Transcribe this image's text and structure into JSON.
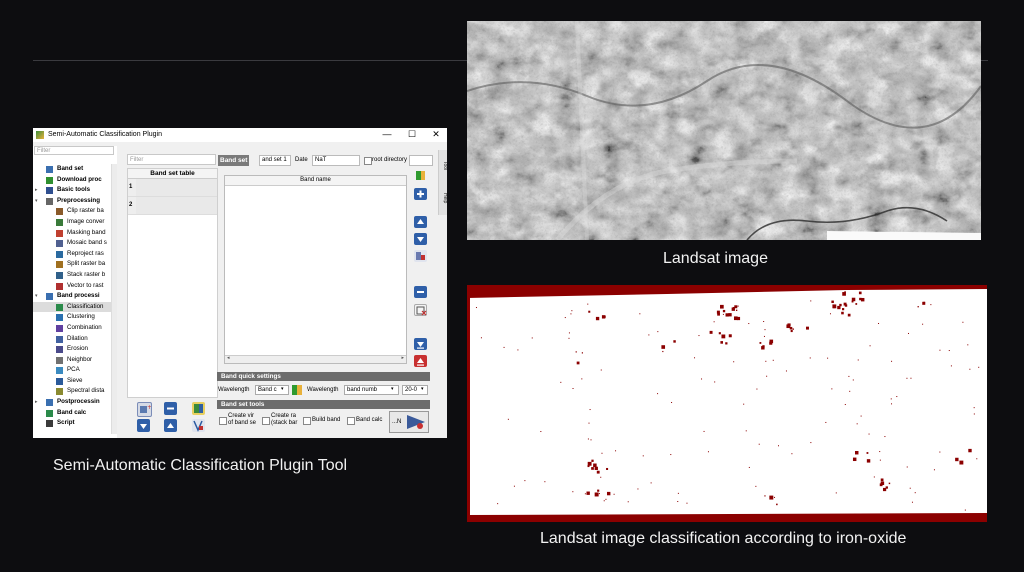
{
  "window": {
    "title": "Semi-Automatic Classification Plugin",
    "controls": {
      "minimize": "—",
      "maximize": "☐",
      "close": "✕"
    }
  },
  "sidebar": {
    "filter_placeholder": "Filter",
    "items": [
      {
        "label": "Band set",
        "bold": true,
        "level": 0,
        "icon": "band-set-icon",
        "color": "#3a6fb0"
      },
      {
        "label": "Download proc",
        "bold": true,
        "level": 0,
        "icon": "download-icon",
        "color": "#2f8f2f"
      },
      {
        "label": "Basic tools",
        "bold": true,
        "level": 0,
        "arrow": "▸",
        "icon": "toolbox-icon",
        "color": "#2f4f8f"
      },
      {
        "label": "Preprocessing",
        "bold": true,
        "level": 0,
        "arrow": "▾",
        "icon": "preprocessing-icon",
        "color": "#666666"
      },
      {
        "label": "Clip raster ba",
        "level": 1,
        "icon": "clip-icon",
        "color": "#8a5a2a"
      },
      {
        "label": "Image conver",
        "level": 1,
        "icon": "image-convert-icon",
        "color": "#3a7a3a"
      },
      {
        "label": "Masking band",
        "level": 1,
        "icon": "mask-icon",
        "color": "#c04030"
      },
      {
        "label": "Mosaic band s",
        "level": 1,
        "icon": "mosaic-icon",
        "color": "#506090"
      },
      {
        "label": "Reproject ras",
        "level": 1,
        "icon": "reproject-icon",
        "color": "#2a6aa0"
      },
      {
        "label": "Split raster ba",
        "level": 1,
        "icon": "split-icon",
        "color": "#a07020"
      },
      {
        "label": "Stack raster b",
        "level": 1,
        "icon": "stack-icon",
        "color": "#30608a"
      },
      {
        "label": "Vector to rast",
        "level": 1,
        "icon": "vector-to-raster-icon",
        "color": "#b03030"
      },
      {
        "label": "Band processi",
        "bold": true,
        "level": 0,
        "arrow": "▾",
        "icon": "band-processing-icon",
        "color": "#3a6fb0"
      },
      {
        "label": "Classification",
        "level": 1,
        "icon": "classification-icon",
        "color": "#2a8a4a",
        "selected": true
      },
      {
        "label": "Clustering",
        "level": 1,
        "icon": "clustering-icon",
        "color": "#2a70b0"
      },
      {
        "label": "Combination",
        "level": 1,
        "icon": "combination-icon",
        "color": "#6040a0"
      },
      {
        "label": "Dilation",
        "level": 1,
        "icon": "dilation-icon",
        "color": "#4060a0"
      },
      {
        "label": "Erosion",
        "level": 1,
        "icon": "erosion-icon",
        "color": "#4a4a8a"
      },
      {
        "label": "Neighbor",
        "level": 1,
        "icon": "neighbor-icon",
        "color": "#707070"
      },
      {
        "label": "PCA",
        "level": 1,
        "icon": "pca-icon",
        "color": "#3a8ac0"
      },
      {
        "label": "Sieve",
        "level": 1,
        "icon": "sieve-icon",
        "color": "#2a5a9a"
      },
      {
        "label": "Spectral dista",
        "level": 1,
        "icon": "spectral-distance-icon",
        "color": "#8a8a30"
      },
      {
        "label": "Postprocessin",
        "bold": true,
        "level": 0,
        "arrow": "▸",
        "icon": "postprocessing-icon",
        "color": "#3a6fb0"
      },
      {
        "label": "Band calc",
        "bold": true,
        "level": 0,
        "icon": "band-calc-icon",
        "color": "#2a8a4a"
      },
      {
        "label": "Script",
        "bold": true,
        "level": 0,
        "icon": "script-icon",
        "color": "#3a3a3a"
      }
    ]
  },
  "band_set_table": {
    "filter_placeholder": "Filter",
    "header": "Band set table",
    "rows": [
      "1",
      "2"
    ]
  },
  "band_set_bar": {
    "label": "Band set",
    "set_value": "and set 1",
    "date_label": "Date",
    "date_value": "NaT",
    "root_dir_label": "root directory"
  },
  "band_table": {
    "header": "Band name",
    "scroll_left": "◂",
    "scroll_right": "▸"
  },
  "quick_settings": {
    "header": "Band quick settings",
    "wavelength_label": "Wavelength",
    "wavelength_value": "Band c",
    "wavelength2_label": "Wavelength",
    "wavelength2_value": "band numb",
    "unit_value": "20-0"
  },
  "tools": {
    "header": "Band set tools",
    "create_vrt": "Create vir\nof band se",
    "create_raster": "Create ra\n(stack bar",
    "build_band": "Build band",
    "band_calc": "Band calc",
    "run_label": "...N"
  },
  "side_tabs": [
    "Tool",
    "Help"
  ],
  "captions": {
    "plugin": "Semi-Automatic Classification Plugin Tool",
    "landsat": "Landsat image",
    "classified": "Landsat image classification according to iron-oxide"
  },
  "colors": {
    "background": "#0d0d10",
    "iron_oxide": "#8b0000",
    "accent_green": "#2f9a2f"
  }
}
